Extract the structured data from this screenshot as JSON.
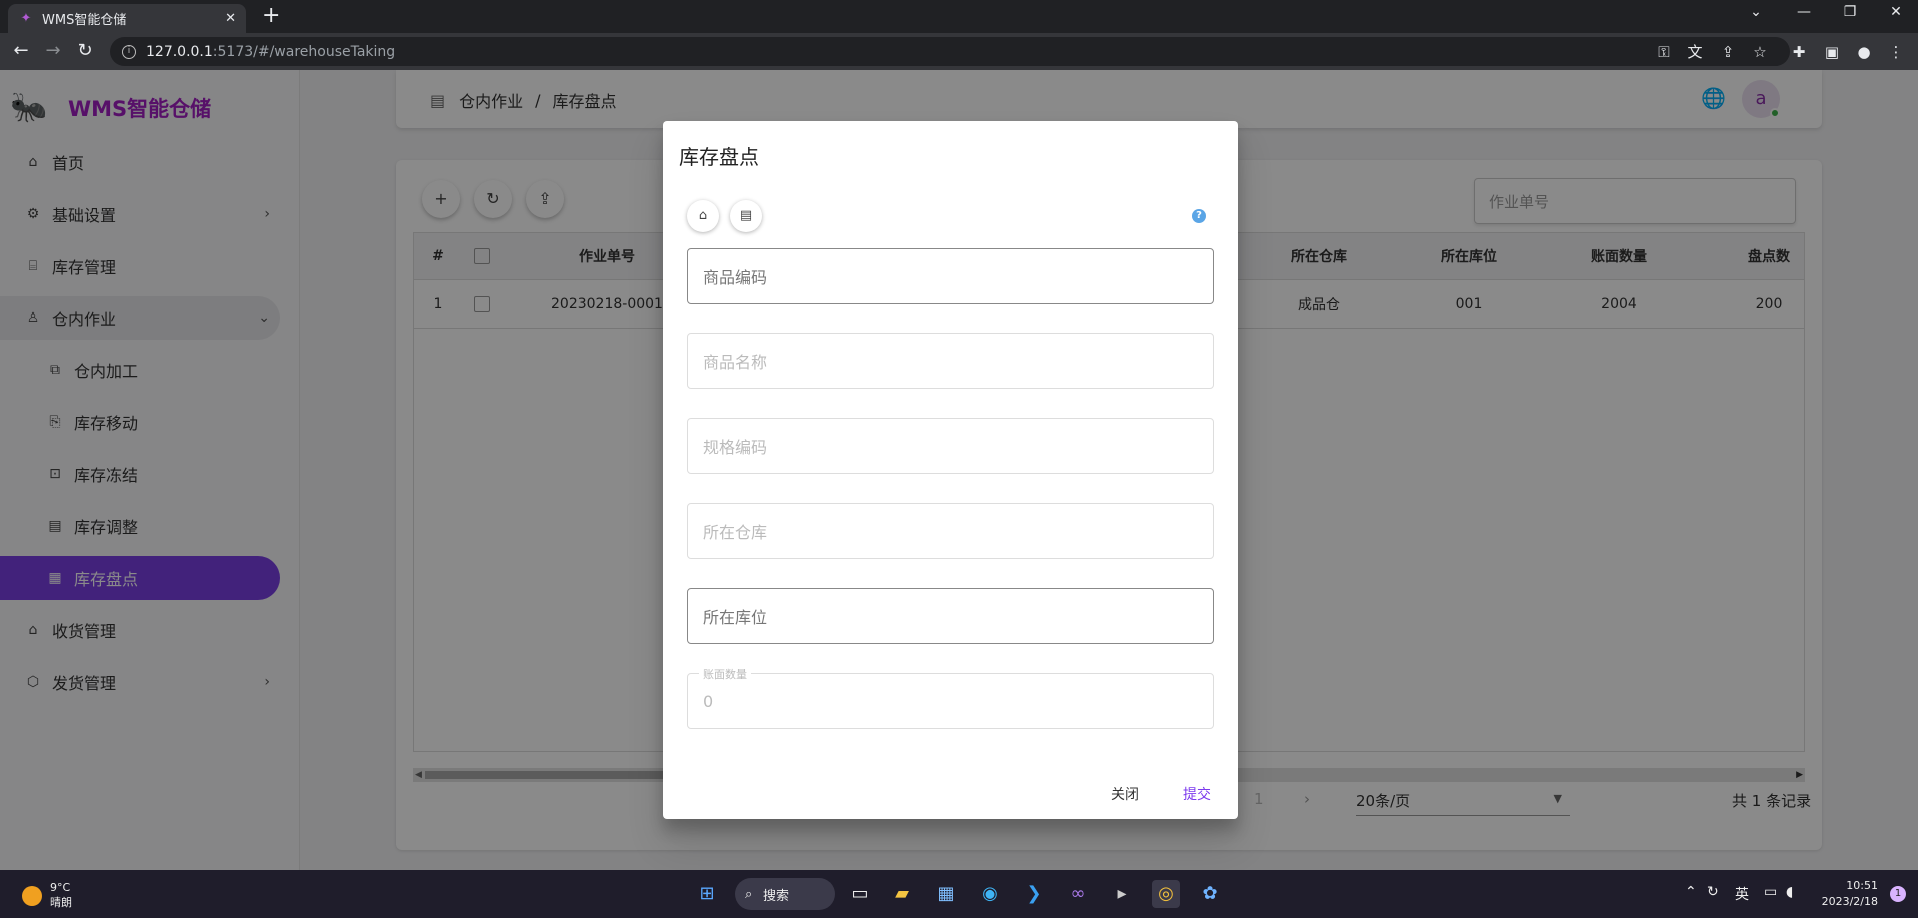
{
  "browser": {
    "tab_title": "WMS智能仓储",
    "url_host": "127.0.0.1",
    "url_path": ":5173/#/warehouseTaking"
  },
  "sidebar": {
    "app_name": "WMS智能仓储",
    "items": [
      {
        "label": "首页"
      },
      {
        "label": "基础设置"
      },
      {
        "label": "库存管理"
      },
      {
        "label": "仓内作业"
      },
      {
        "label": "仓内加工"
      },
      {
        "label": "库存移动"
      },
      {
        "label": "库存冻结"
      },
      {
        "label": "库存调整"
      },
      {
        "label": "库存盘点"
      },
      {
        "label": "收货管理"
      },
      {
        "label": "发货管理"
      }
    ]
  },
  "header": {
    "breadcrumb_parent": "仓内作业",
    "breadcrumb_sep": "/",
    "breadcrumb_current": "库存盘点",
    "avatar_letter": "a"
  },
  "toolbar": {
    "search_placeholder": "作业单号"
  },
  "table": {
    "columns": [
      "#",
      "作业单号",
      "所在仓库",
      "所在库位",
      "账面数量",
      "盘点数"
    ],
    "rows": [
      {
        "index": "1",
        "job_no": "20230218-0001",
        "warehouse": "成品仓",
        "location": "001",
        "book_qty": "2004",
        "count_qty": "200"
      }
    ]
  },
  "pagination": {
    "page_num": "1",
    "page_size": "20条/页",
    "total": "共 1 条记录"
  },
  "dialog": {
    "title": "库存盘点",
    "help": "?",
    "fields": [
      {
        "placeholder": "商品编码"
      },
      {
        "placeholder": "商品名称"
      },
      {
        "placeholder": "规格编码"
      },
      {
        "placeholder": "所在仓库"
      },
      {
        "placeholder": "所在库位"
      },
      {
        "label": "账面数量",
        "value": "0"
      }
    ],
    "close_label": "关闭",
    "submit_label": "提交"
  },
  "taskbar": {
    "temperature": "9°C",
    "weather": "晴朗",
    "search_label": "搜索",
    "ime": "英",
    "time": "10:51",
    "date": "2023/2/18",
    "notif_count": "1"
  },
  "colors": {
    "accent": "#7b3fe4",
    "brand": "#a21fc2",
    "submit": "#7c3aed"
  }
}
